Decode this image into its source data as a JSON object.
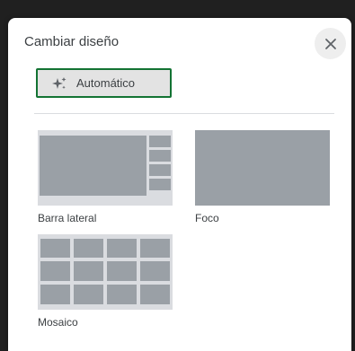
{
  "dialog": {
    "title": "Cambiar diseño",
    "close_icon": "close-icon"
  },
  "auto_button": {
    "label": "Automático",
    "icon": "sparkle-icon",
    "border_color": "#137333"
  },
  "layouts": [
    {
      "label": "Barra lateral",
      "icon": "sidebar-layout-thumbnail"
    },
    {
      "label": "Foco",
      "icon": "spotlight-layout-thumbnail"
    },
    {
      "label": "Mosaico",
      "icon": "tiled-layout-thumbnail"
    }
  ],
  "colors": {
    "tile": "#9aa0a6",
    "tile_background": "#dadce0"
  }
}
